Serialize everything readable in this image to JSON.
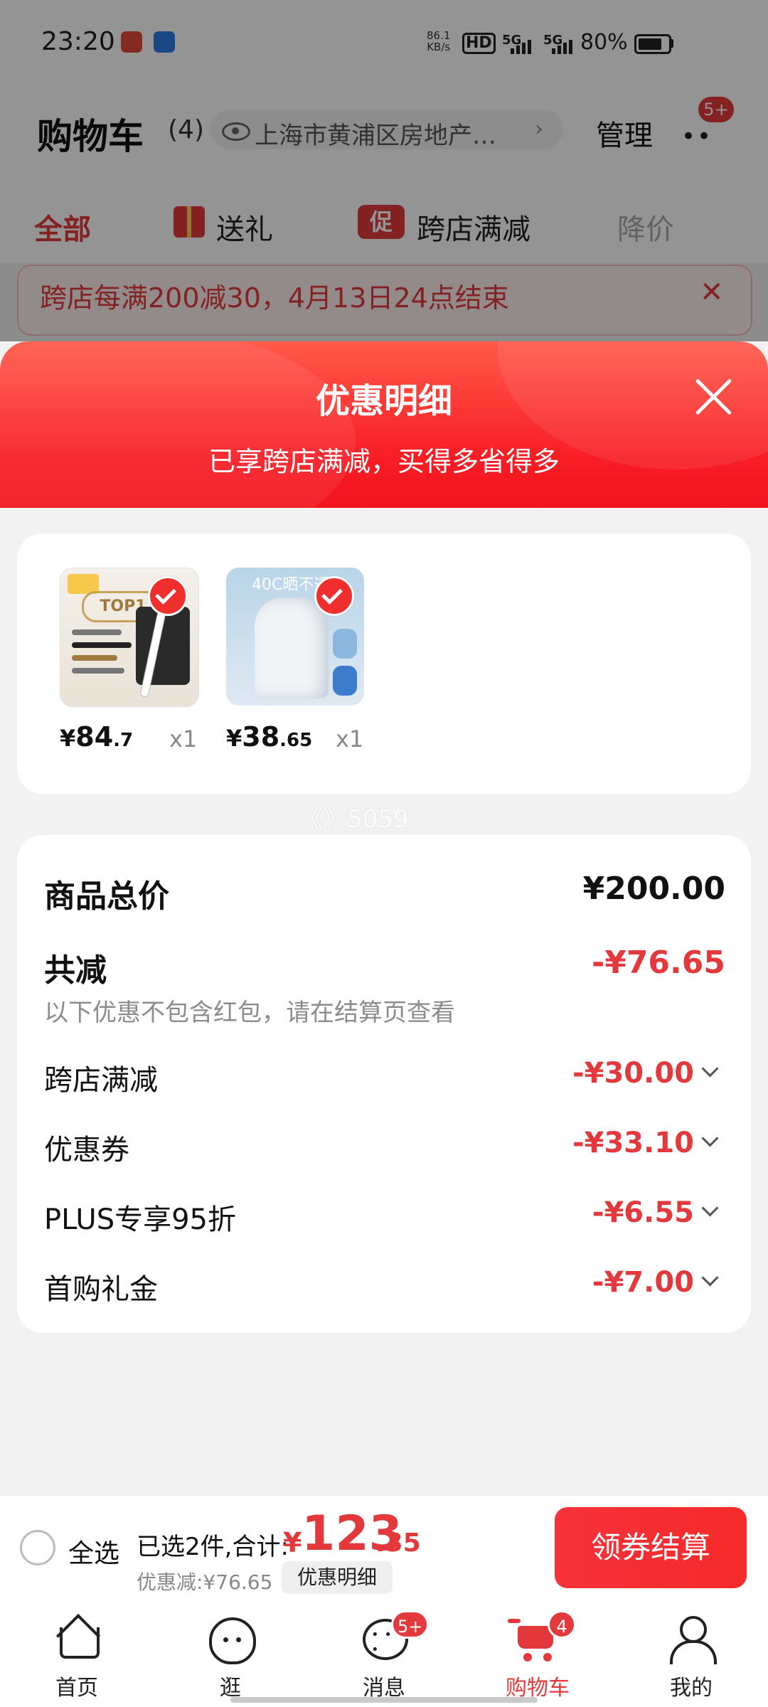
{
  "status_bar": {
    "time": "23:20",
    "net_speed_value": "86.1",
    "net_speed_unit": "KB/s",
    "hd_label": "HD",
    "signal1": "5G",
    "signal2": "5G",
    "battery": "80%"
  },
  "header": {
    "title": "购物车",
    "count": "(4)",
    "address": "上海市黄浦区房地产…",
    "manage_label": "管理",
    "more_badge": "5+"
  },
  "tabs": [
    {
      "label": "全部",
      "state": "active"
    },
    {
      "label": "送礼",
      "icon": "gift-icon"
    },
    {
      "label": "跨店满减",
      "icon": "promo-icon",
      "icon_text": "促"
    },
    {
      "label": "降价",
      "state": "gray"
    }
  ],
  "promo_banner": {
    "text": "跨店每满200减30，4月13日24点结束",
    "close_icon": "close-icon"
  },
  "sheet": {
    "title": "优惠明细",
    "subtitle": "已享跨店满减，买得多省得多",
    "close_icon": "close-icon",
    "products": [
      {
        "badge_text": "TOP1",
        "price_currency": "¥",
        "price_int": "84",
        "price_dec": ".7",
        "qty": "x1",
        "selected": true
      },
      {
        "caption": "40C晒不透",
        "price_currency": "¥",
        "price_int": "38",
        "price_dec": ".65",
        "qty": "x1",
        "selected": true
      }
    ],
    "watermark": "《》5059",
    "summary": {
      "total_label": "商品总价",
      "total_value": "¥200.00",
      "discount_label": "共减",
      "discount_value": "-¥76.65",
      "hint": "以下优惠不包含红包，请在结算页查看",
      "items": [
        {
          "label": "跨店满减",
          "value": "-¥30.00"
        },
        {
          "label": "优惠券",
          "value": "-¥33.10"
        },
        {
          "label": "PLUS专享95折",
          "value": "-¥6.55"
        },
        {
          "label": "首购礼金",
          "value": "-¥7.00"
        }
      ]
    }
  },
  "checkout": {
    "select_all": "全选",
    "selected_text": "已选2件,合计:",
    "total_currency": "¥",
    "total_int": "123",
    "total_dec": ".35",
    "saved_text": "优惠减:¥76.65",
    "detail_label": "优惠明细",
    "button_label": "领券结算"
  },
  "tabbar": [
    {
      "label": "首页",
      "icon": "home-icon"
    },
    {
      "label": "逛",
      "icon": "browse-icon"
    },
    {
      "label": "消息",
      "icon": "message-icon",
      "badge": "5+"
    },
    {
      "label": "购物车",
      "icon": "cart-icon",
      "badge": "4",
      "active": true
    },
    {
      "label": "我的",
      "icon": "profile-icon"
    }
  ],
  "colors": {
    "accent": "#e4393c",
    "sheet_header": "#f81d24"
  }
}
